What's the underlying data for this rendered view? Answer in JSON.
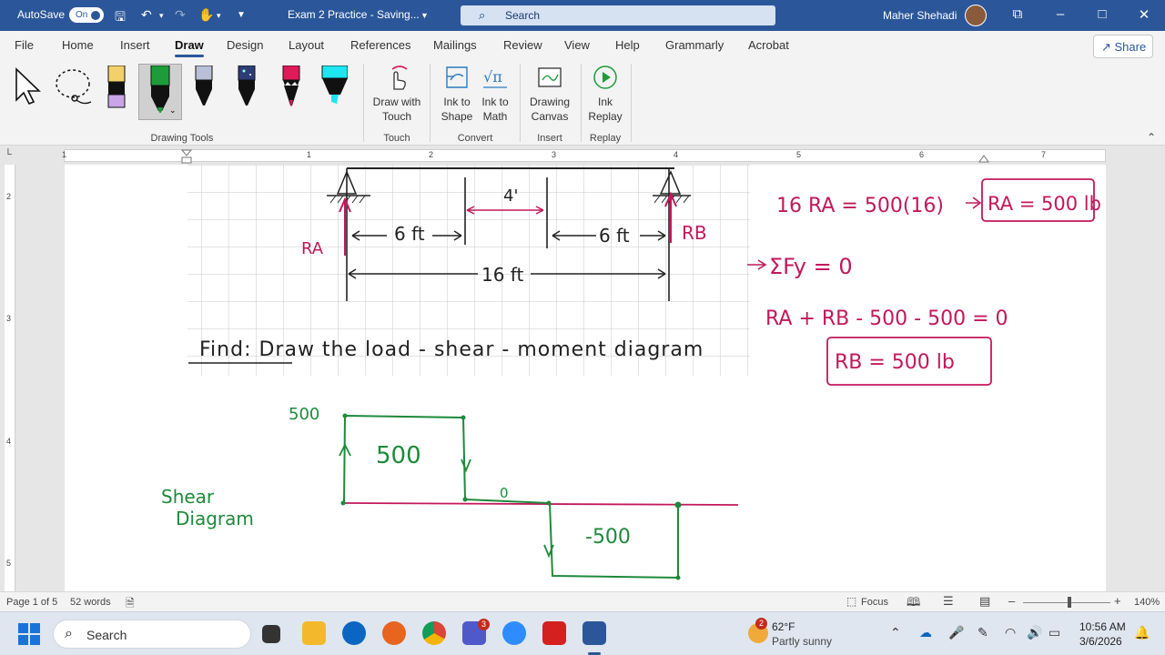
{
  "titlebar": {
    "autosave_label": "AutoSave",
    "toggle_state": "On",
    "doc_title": "Exam 2 Practice  -  Saving...",
    "search_placeholder": "Search",
    "user_name": "Maher Shehadi"
  },
  "tabs": [
    "File",
    "Home",
    "Insert",
    "Draw",
    "Design",
    "Layout",
    "References",
    "Mailings",
    "Review",
    "View",
    "Help",
    "Grammarly",
    "Acrobat"
  ],
  "active_tab": "Draw",
  "share_label": "Share",
  "ribbon": {
    "group_drawing_tools": "Drawing Tools",
    "draw_with_touch": [
      "Draw with",
      "Touch"
    ],
    "group_touch": "Touch",
    "ink_to_shape": [
      "Ink to",
      "Shape"
    ],
    "ink_to_math": [
      "Ink to",
      "Math"
    ],
    "group_convert": "Convert",
    "drawing_canvas": [
      "Drawing",
      "Canvas"
    ],
    "group_insert": "Insert",
    "ink_replay": [
      "Ink",
      "Replay"
    ],
    "group_replay": "Replay",
    "pen_colors": [
      "#f2d06b",
      "#1e9c3a",
      "#b8bfd6",
      "#2d3c78",
      "#e0195a",
      "#1ee6f0"
    ]
  },
  "ruler": {
    "h_numbers": [
      "1",
      "1",
      "2",
      "3",
      "4",
      "5",
      "6",
      "7"
    ],
    "v_numbers": [
      "2",
      "3",
      "4",
      "5"
    ]
  },
  "page": {
    "find_text": "Find:  Draw the load - shear - moment diagram",
    "label_4ft": "4'",
    "label_6ft_left": "6 ft",
    "label_6ft_right": "6 ft",
    "label_16ft": "16 ft",
    "label_ra": "RA",
    "label_rb": "RB",
    "eq1": "16 RA = 500(16)",
    "eq1_result": "RA = 500 lb",
    "eq2": "ΣFy = 0",
    "eq3": "RA + RB - 500 - 500 = 0",
    "eq3_result": "RB = 500 lb",
    "shear_y_label": "500",
    "shear_pos_value": "500",
    "shear_zero": "0",
    "shear_neg_value": "-500",
    "shear_title_1": "Shear",
    "shear_title_2": "Diagram"
  },
  "statusbar": {
    "page": "Page 1 of 5",
    "words": "52 words",
    "focus": "Focus",
    "zoom": "140%"
  },
  "taskbar": {
    "search": "Search",
    "weather_temp": "62°F",
    "weather_desc": "Partly sunny",
    "weather_badge": "2",
    "teams_badge": "3",
    "time": "10:56 AM",
    "date": "3/6/2026"
  }
}
